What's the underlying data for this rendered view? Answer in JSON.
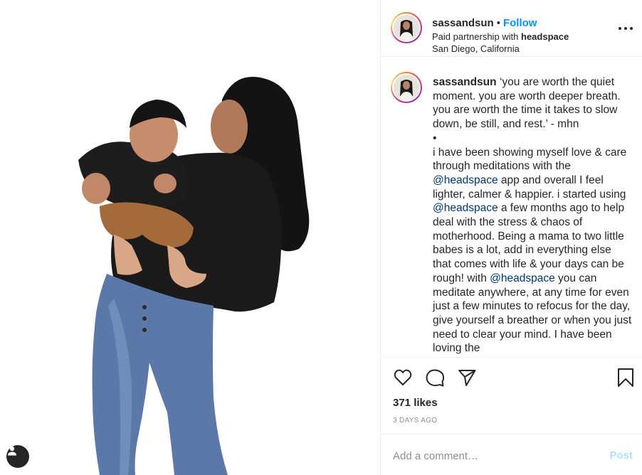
{
  "post": {
    "username": "sassandsun",
    "dot": "•",
    "follow_label": "Follow",
    "partnership_prefix": "Paid partnership with ",
    "partner": "headspace",
    "location": "San Diego, California",
    "more_label": "More options"
  },
  "caption": {
    "username": "sassandsun",
    "quote": "‘you are worth the quiet moment. you are worth deeper breath. you are worth the time it takes to slow down, be still, and rest.’ - mhn",
    "bullet": "•",
    "p1": "i have been showing myself love & care through meditations with the ",
    "mention1": "@headspace",
    "p2": " app and overall I feel lighter, calmer & happier. i started using ",
    "mention2": "@headspace",
    "p3": " a few months ago to help deal with the stress & chaos of motherhood. Being a mama to two little babes is a lot, add in everything else that comes with life & your days can be rough! with ",
    "mention3": "@headspace",
    "p4": " you can meditate anywhere, at any time for even just a few minutes to refocus for the day, give yourself a breather or when you just need to clear your mind. I have been loving the"
  },
  "actions": {
    "likes": "371 likes",
    "time": "3 DAYS AGO"
  },
  "comment": {
    "placeholder": "Add a comment…",
    "post_label": "Post"
  },
  "icons": {
    "like": "heart-icon",
    "comment": "comment-bubble-icon",
    "share": "paper-plane-icon",
    "save": "bookmark-icon",
    "tag": "user-tag-icon",
    "more": "more-dots-icon"
  },
  "colors": {
    "follow": "#0095f6",
    "mention": "#00376b",
    "post_disabled": "#b2dffc",
    "muted": "#8e8e8e",
    "border": "#efefef"
  }
}
